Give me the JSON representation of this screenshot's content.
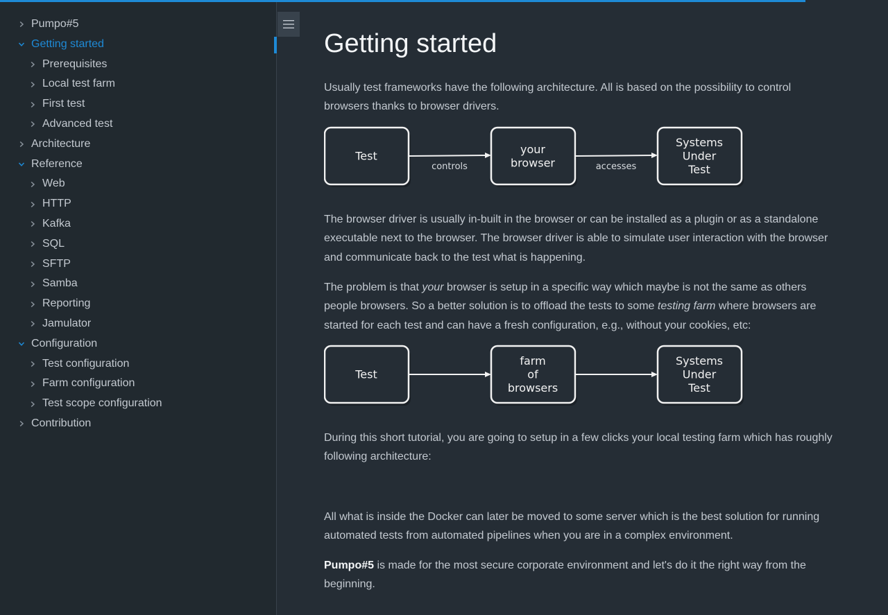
{
  "progress": {
    "percent": 90.7,
    "color": "#1e8ad6"
  },
  "sidebar": {
    "items": [
      {
        "label": "Pumpo#5",
        "level": 1,
        "state": "collapsed"
      },
      {
        "label": "Getting started",
        "level": 1,
        "state": "expanded",
        "active": true
      },
      {
        "label": "Prerequisites",
        "level": 2,
        "state": "collapsed"
      },
      {
        "label": "Local test farm",
        "level": 2,
        "state": "collapsed"
      },
      {
        "label": "First test",
        "level": 2,
        "state": "collapsed"
      },
      {
        "label": "Advanced test",
        "level": 2,
        "state": "collapsed"
      },
      {
        "label": "Architecture",
        "level": 1,
        "state": "collapsed"
      },
      {
        "label": "Reference",
        "level": 1,
        "state": "expanded"
      },
      {
        "label": "Web",
        "level": 2,
        "state": "collapsed"
      },
      {
        "label": "HTTP",
        "level": 2,
        "state": "collapsed"
      },
      {
        "label": "Kafka",
        "level": 2,
        "state": "collapsed"
      },
      {
        "label": "SQL",
        "level": 2,
        "state": "collapsed"
      },
      {
        "label": "SFTP",
        "level": 2,
        "state": "collapsed"
      },
      {
        "label": "Samba",
        "level": 2,
        "state": "collapsed"
      },
      {
        "label": "Reporting",
        "level": 2,
        "state": "collapsed"
      },
      {
        "label": "Jamulator",
        "level": 2,
        "state": "collapsed"
      },
      {
        "label": "Configuration",
        "level": 1,
        "state": "expanded"
      },
      {
        "label": "Test configuration",
        "level": 2,
        "state": "collapsed"
      },
      {
        "label": "Farm configuration",
        "level": 2,
        "state": "collapsed"
      },
      {
        "label": "Test scope configuration",
        "level": 2,
        "state": "collapsed"
      },
      {
        "label": "Contribution",
        "level": 1,
        "state": "collapsed"
      }
    ]
  },
  "icons": {
    "menu_toggle": "hamburger-icon",
    "chevron_collapsed": "chevron-right-icon",
    "chevron_expanded": "chevron-down-icon"
  },
  "main": {
    "title": "Getting started",
    "p1": "Usually test frameworks have the following architecture. All is based on the possibility to control browsers thanks to browser drivers.",
    "diagram1": {
      "box1": [
        "Test"
      ],
      "box2": [
        "your",
        "browser"
      ],
      "box3": [
        "Systems",
        "Under",
        "Test"
      ],
      "arrow1_label": "controls",
      "arrow2_label": "accesses"
    },
    "p2": "The browser driver is usually in-built in the browser or can be installed as a plugin or as a standalone executable next to the browser. The browser driver is able to simulate user interaction with the browser and communicate back to the test what is happening.",
    "p3": {
      "t1": "The problem is that ",
      "em1": "your",
      "t2": " browser is setup in a specific way which maybe is not the same as others people browsers. So a better solution is to offload the tests to some ",
      "em2": "testing farm",
      "t3": " where browsers are started for each test and can have a fresh configuration, e.g., without your cookies, etc:"
    },
    "diagram2": {
      "box1": [
        "Test"
      ],
      "box2": [
        "farm",
        "of",
        "browsers"
      ],
      "box3": [
        "Systems",
        "Under",
        "Test"
      ]
    },
    "p4": "During this short tutorial, you are going to setup in a few clicks your local testing farm which has roughly following architecture:",
    "p5": "All what is inside the Docker can later be moved to some server which is the best solution for running automated tests from automated pipelines when you are in a complex environment.",
    "p6": {
      "strong": "Pumpo#5",
      "text": " is made for the most secure corporate environment and let's do it the right way from the beginning."
    }
  }
}
